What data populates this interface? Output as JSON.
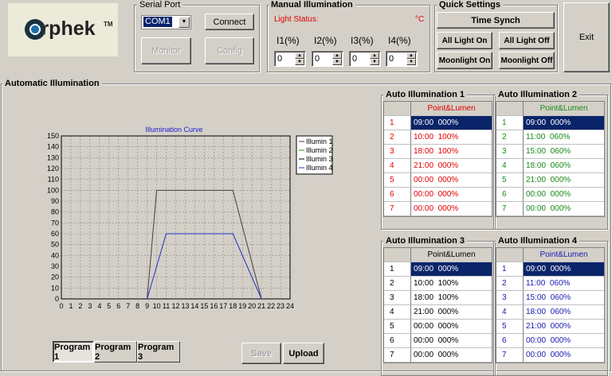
{
  "logo": {
    "text": "Orphek",
    "tm": "TM"
  },
  "serial_port": {
    "title": "Serial Port",
    "port_value": "COM1",
    "connect": "Connect",
    "monitor": "Monitor",
    "config": "Config"
  },
  "manual": {
    "title": "Manual Illumination",
    "light_status": "Light Status:",
    "unit": "°C",
    "channels": [
      {
        "label": "I1(%)",
        "value": "0"
      },
      {
        "label": "I2(%)",
        "value": "0"
      },
      {
        "label": "I3(%)",
        "value": "0"
      },
      {
        "label": "I4(%)",
        "value": "0"
      }
    ]
  },
  "quick": {
    "title": "Quick Settings",
    "time_synch": "Time Synch",
    "all_on": "All Light On",
    "all_off": "All Light Off",
    "moon_on": "Moonlight On",
    "moon_off": "Moonlight Off"
  },
  "exit": "Exit",
  "auto": {
    "title": "Automatic Illumination"
  },
  "chart_data": {
    "type": "line",
    "title": "Illumination Curve",
    "xlabel": "",
    "ylabel": "",
    "xlim": [
      0,
      24
    ],
    "ylim": [
      0,
      150
    ],
    "x_ticks": [
      0,
      1,
      2,
      3,
      4,
      5,
      6,
      7,
      8,
      9,
      10,
      11,
      12,
      13,
      14,
      15,
      16,
      17,
      18,
      19,
      20,
      21,
      22,
      23,
      24
    ],
    "y_ticks": [
      0,
      10,
      20,
      30,
      40,
      50,
      60,
      70,
      80,
      90,
      100,
      110,
      120,
      130,
      140,
      150
    ],
    "grid": true,
    "legend": "top-right",
    "series": [
      {
        "name": "Illumin 1",
        "color": "#404040",
        "points": [
          [
            9,
            0
          ],
          [
            10,
            100
          ],
          [
            18,
            100
          ],
          [
            21,
            0
          ]
        ]
      },
      {
        "name": "Illumin 2",
        "color": "#2a8a2a",
        "points": []
      },
      {
        "name": "Illumin 3",
        "color": "#000000",
        "points": []
      },
      {
        "name": "Illumin 4",
        "color": "#2030c0",
        "points": [
          [
            9,
            0
          ],
          [
            11,
            60
          ],
          [
            18,
            60
          ],
          [
            21,
            0
          ]
        ]
      }
    ]
  },
  "tables": [
    {
      "title": "Auto Illumination 1",
      "header": "Point&Lumen",
      "color": "#e00000",
      "rows": [
        {
          "n": "1",
          "v": "09:00  000%"
        },
        {
          "n": "2",
          "v": "10:00  100%"
        },
        {
          "n": "3",
          "v": "18:00  100%"
        },
        {
          "n": "4",
          "v": "21:00  000%"
        },
        {
          "n": "5",
          "v": "00:00  000%"
        },
        {
          "n": "6",
          "v": "00:00  000%"
        },
        {
          "n": "7",
          "v": "00:00  000%"
        }
      ]
    },
    {
      "title": "Auto Illumination 2",
      "header": "Point&Lumen",
      "color": "#1a8a1a",
      "rows": [
        {
          "n": "1",
          "v": "09:00  000%"
        },
        {
          "n": "2",
          "v": "11:00  060%"
        },
        {
          "n": "3",
          "v": "15:00  060%"
        },
        {
          "n": "4",
          "v": "18:00  060%"
        },
        {
          "n": "5",
          "v": "21:00  000%"
        },
        {
          "n": "6",
          "v": "00:00  000%"
        },
        {
          "n": "7",
          "v": "00:00  000%"
        }
      ]
    },
    {
      "title": "Auto Illumination 3",
      "header": "Point&Lumen",
      "color": "#000000",
      "rows": [
        {
          "n": "1",
          "v": "09:00  000%"
        },
        {
          "n": "2",
          "v": "10:00  100%"
        },
        {
          "n": "3",
          "v": "18:00  100%"
        },
        {
          "n": "4",
          "v": "21:00  000%"
        },
        {
          "n": "5",
          "v": "00:00  000%"
        },
        {
          "n": "6",
          "v": "00:00  000%"
        },
        {
          "n": "7",
          "v": "00:00  000%"
        }
      ]
    },
    {
      "title": "Auto Illumination 4",
      "header": "Point&Lumen",
      "color": "#1a1ab0",
      "rows": [
        {
          "n": "1",
          "v": "09:00  000%"
        },
        {
          "n": "2",
          "v": "11:00  060%"
        },
        {
          "n": "3",
          "v": "15:00  060%"
        },
        {
          "n": "4",
          "v": "18:00  060%"
        },
        {
          "n": "5",
          "v": "21:00  000%"
        },
        {
          "n": "6",
          "v": "00:00  000%"
        },
        {
          "n": "7",
          "v": "00:00  000%"
        }
      ]
    }
  ],
  "programs": [
    "Program 1",
    "Program 2",
    "Program 3"
  ],
  "save": "Save",
  "upload": "Upload"
}
